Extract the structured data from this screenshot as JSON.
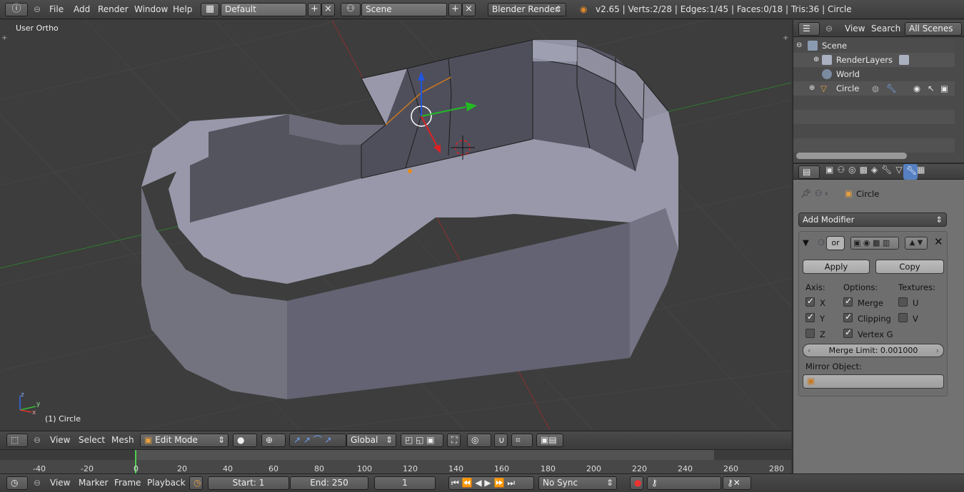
{
  "topbar": {
    "menus": [
      "File",
      "Add",
      "Render",
      "Window",
      "Help"
    ],
    "layout": "Default",
    "scene": "Scene",
    "engine": "Blender Render",
    "stats": "v2.65 | Verts:2/28 | Edges:1/45 | Faces:0/18 | Tris:36 | Circle"
  },
  "viewport": {
    "view_label": "User Ortho",
    "object_label": "(1) Circle",
    "axis_z": "z",
    "axis_y": "y",
    "axis_x": "x"
  },
  "vp_header": {
    "menus": [
      "View",
      "Select",
      "Mesh"
    ],
    "mode": "Edit Mode",
    "orientation": "Global"
  },
  "timeline": {
    "ticks": [
      "-40",
      "-20",
      "0",
      "20",
      "40",
      "60",
      "80",
      "100",
      "120",
      "140",
      "160",
      "180",
      "200",
      "220",
      "240",
      "260",
      "280"
    ],
    "menus": [
      "View",
      "Marker",
      "Frame",
      "Playback"
    ],
    "start": "Start: 1",
    "end": "End: 250",
    "current": "1",
    "sync": "No Sync"
  },
  "outliner": {
    "menus": [
      "View",
      "Search"
    ],
    "filter": "All Scenes",
    "items": [
      "Scene",
      "RenderLayers",
      "World",
      "Circle"
    ]
  },
  "properties": {
    "breadcrumb": "Circle",
    "add_modifier": "Add Modifier",
    "modifier_name": "or",
    "apply": "Apply",
    "copy": "Copy",
    "axis_title": "Axis:",
    "options_title": "Options:",
    "textures_title": "Textures:",
    "axis_x": "X",
    "axis_y": "Y",
    "axis_z": "Z",
    "opt_merge": "Merge",
    "opt_clipping": "Clipping",
    "opt_vertex": "Vertex G",
    "tex_u": "U",
    "tex_v": "V",
    "merge_limit": "Merge Limit: 0.001000",
    "mirror_object": "Mirror Object:"
  },
  "colors": {
    "accent_blue": "#5680c2",
    "mesh_face": "#8a8a9a",
    "grid_red": "#a33",
    "grid_green": "#3a3"
  }
}
